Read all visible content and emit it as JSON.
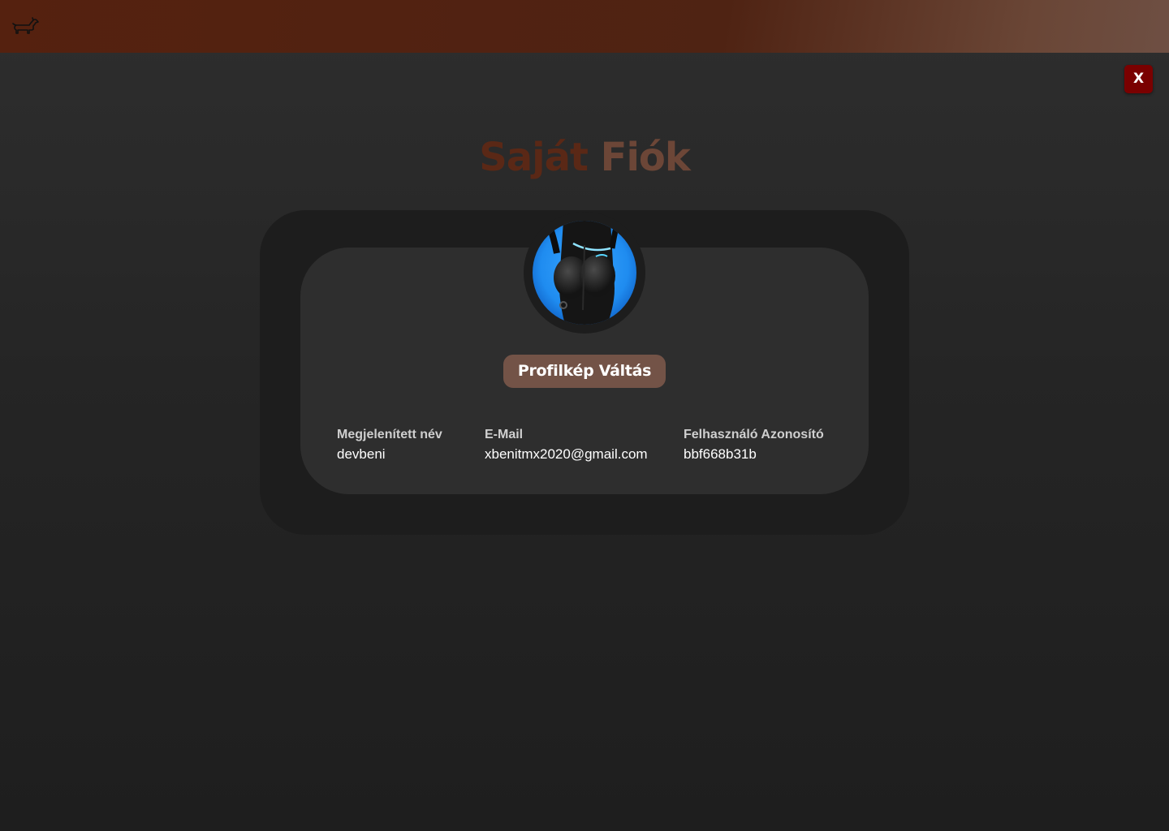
{
  "header": {
    "logo_icon": "dachshund-dog-icon"
  },
  "close_button": {
    "label": "X",
    "color": "#7a0000"
  },
  "page": {
    "title_word1": "Saját",
    "title_word2": "Fiók"
  },
  "profile": {
    "avatar_icon": "profile-avatar-image",
    "change_picture_label": "Profilkép Váltás",
    "fields": {
      "display_name": {
        "label": "Megjelenített név",
        "value": "devbeni"
      },
      "email": {
        "label": "E-Mail",
        "value": "xbenitmx2020@gmail.com"
      },
      "user_id": {
        "label": "Felhasználó Azonosító",
        "value": "bbf668b31b"
      }
    }
  },
  "colors": {
    "header_brown": "#55210f",
    "accent_button": "#735347",
    "close_red": "#7a0000",
    "card_outer": "#1d1d1d",
    "card_inner": "#2e2e2e"
  }
}
